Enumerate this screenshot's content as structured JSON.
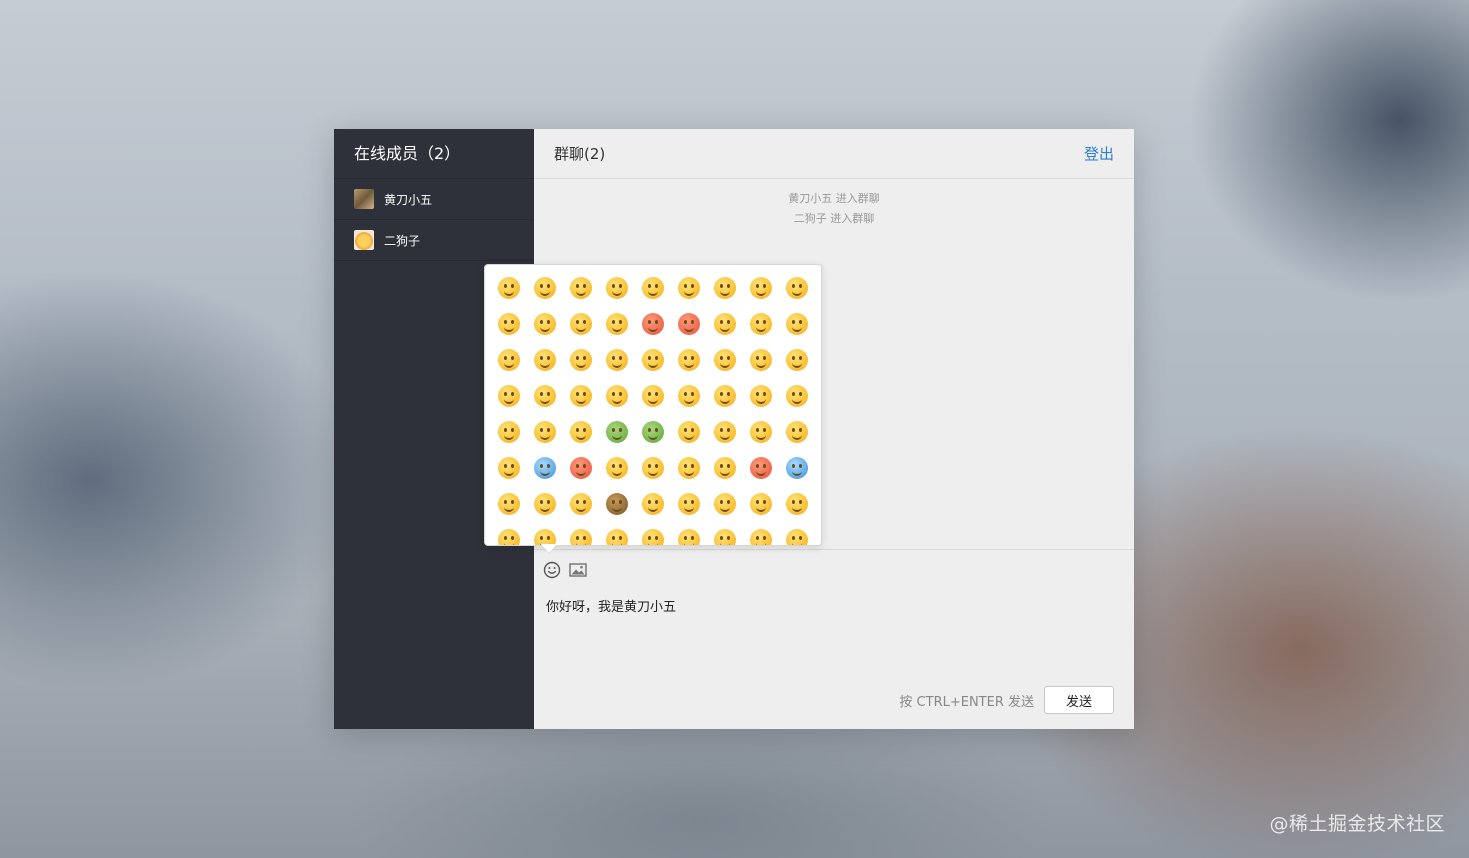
{
  "watermark": "@稀土掘金技术社区",
  "sidebar": {
    "title": "在线成员（2）",
    "members": [
      {
        "name": "黄刀小五",
        "avatar": "avatar-photo-1"
      },
      {
        "name": "二狗子",
        "avatar": "avatar-photo-2"
      }
    ]
  },
  "header": {
    "title": "群聊(2)",
    "logout_label": "登出"
  },
  "messages": {
    "system": [
      "黄刀小五 进入群聊",
      "二狗子 进入群聊"
    ]
  },
  "toolbar": {
    "emoji_icon": "smile-icon",
    "image_icon": "image-icon"
  },
  "compose": {
    "value": "你好呀，我是黄刀小五"
  },
  "send": {
    "hint": "按 CTRL+ENTER 发送",
    "button_label": "发送"
  },
  "emoji_panel": {
    "columns": 9,
    "visible_rows": 8,
    "emojis": [
      "😀",
      "😃",
      "😄",
      "😁",
      "😆",
      "😅",
      "🤣",
      "😂",
      "🙂",
      "🙃",
      "😉",
      "😊",
      "😇",
      "🥰",
      "😍",
      "🤩",
      "😘",
      "😗",
      "☺️",
      "😚",
      "😙",
      "😋",
      "😛",
      "😜",
      "🤪",
      "😝",
      "🤑",
      "🤗",
      "🤭",
      "🤫",
      "🤔",
      "🤐",
      "🤨",
      "😐",
      "😑",
      "😶",
      "😏",
      "😒",
      "🙄",
      "😬",
      "🤥",
      "😌",
      "😔",
      "😪",
      "🤤",
      "😴",
      "😷",
      "🤒",
      "🤕",
      "🤢",
      "🤮",
      "🤧",
      "🥵",
      "🥶",
      "🥴",
      "😵",
      "🤯",
      "🤠",
      "🥳",
      "😎",
      "🤓",
      "🧐",
      "😕",
      "😟",
      "🙁",
      "😮",
      "😯",
      "😲",
      "😳",
      "🥺",
      "😦",
      "😧"
    ],
    "tints": {
      "13": "red",
      "14": "red",
      "46": "blue",
      "47": "red",
      "52": "red",
      "53": "blue",
      "39": "green",
      "40": "green",
      "57": "dark"
    }
  }
}
